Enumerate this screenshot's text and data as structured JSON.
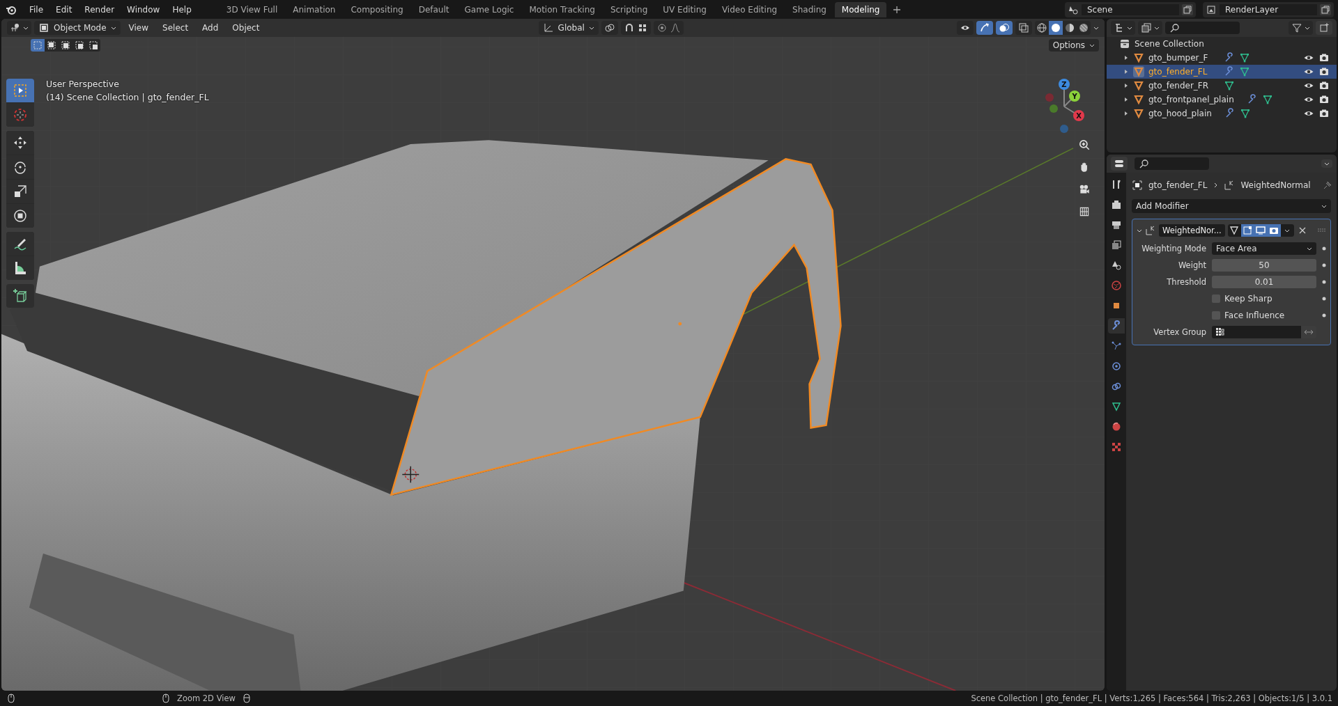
{
  "menu": [
    "File",
    "Edit",
    "Render",
    "Window",
    "Help"
  ],
  "workspaces": [
    {
      "label": "3D View Full",
      "selected": false
    },
    {
      "label": "Animation",
      "selected": false
    },
    {
      "label": "Compositing",
      "selected": false
    },
    {
      "label": "Default",
      "selected": false
    },
    {
      "label": "Game Logic",
      "selected": false
    },
    {
      "label": "Motion Tracking",
      "selected": false
    },
    {
      "label": "Scripting",
      "selected": false
    },
    {
      "label": "UV Editing",
      "selected": false
    },
    {
      "label": "Video Editing",
      "selected": false
    },
    {
      "label": "Shading",
      "selected": false
    },
    {
      "label": "Modeling",
      "selected": true
    }
  ],
  "scene": "Scene",
  "view_layer": "RenderLayer",
  "viewport": {
    "mode": "Object Mode",
    "menus": [
      "View",
      "Select",
      "Add",
      "Object"
    ],
    "orientation": "Global",
    "options": "Options",
    "select_modes": [
      {
        "selected": true
      },
      {
        "selected": false
      },
      {
        "selected": false
      },
      {
        "selected": false
      },
      {
        "selected": false
      }
    ],
    "shading": [
      {
        "kind": "wireframe",
        "selected": false
      },
      {
        "kind": "solid",
        "selected": true
      },
      {
        "kind": "material",
        "selected": false
      },
      {
        "kind": "rendered",
        "selected": false
      }
    ],
    "view_name": "User Perspective",
    "info": "(14) Scene Collection | gto_fender_FL",
    "gizmo": {
      "x": "X",
      "y": "Y",
      "z": "Z"
    },
    "tool_groups": [
      {
        "tools": [
          {
            "kind": "select",
            "selected": true
          },
          {
            "kind": "cursor",
            "selected": false
          }
        ]
      },
      {
        "tools": [
          {
            "kind": "move",
            "selected": false
          },
          {
            "kind": "rotate",
            "selected": false
          },
          {
            "kind": "scale",
            "selected": false
          },
          {
            "kind": "transform",
            "selected": false
          }
        ]
      },
      {
        "tools": [
          {
            "kind": "annotate",
            "selected": false
          },
          {
            "kind": "measure",
            "selected": false
          }
        ]
      },
      {
        "tools": [
          {
            "kind": "add-cube",
            "selected": false
          }
        ]
      }
    ]
  },
  "outliner": {
    "root": {
      "label": "Scene Collection",
      "children": [
        {
          "name": "gto_bumper_F",
          "selected": false,
          "has_modifier": true,
          "expanded": false
        },
        {
          "name": "gto_fender_FL",
          "selected": true,
          "has_modifier": true,
          "expanded": false
        },
        {
          "name": "gto_fender_FR",
          "selected": false,
          "has_modifier": false,
          "expanded": false
        },
        {
          "name": "gto_frontpanel_plain",
          "selected": false,
          "has_modifier": true,
          "expanded": false
        },
        {
          "name": "gto_hood_plain",
          "selected": false,
          "has_modifier": true,
          "expanded": false
        }
      ]
    }
  },
  "properties": {
    "tabs": [
      {
        "kind": "tool",
        "selected": false
      },
      {
        "kind": "render",
        "selected": false
      },
      {
        "kind": "output",
        "selected": false
      },
      {
        "kind": "view-layer",
        "selected": false
      },
      {
        "kind": "scene",
        "selected": false
      },
      {
        "kind": "world",
        "selected": false
      },
      {
        "kind": "object",
        "selected": false
      },
      {
        "kind": "modifier",
        "selected": true
      },
      {
        "kind": "particles",
        "selected": false
      },
      {
        "kind": "physics",
        "selected": false
      },
      {
        "kind": "constraints",
        "selected": false
      },
      {
        "kind": "data",
        "selected": false
      },
      {
        "kind": "material",
        "selected": false
      },
      {
        "kind": "texture",
        "selected": false
      }
    ],
    "object": "gto_fender_FL",
    "modifier": "WeightedNormal",
    "add_modifier": "Add Modifier",
    "panel": {
      "name": "WeightedNor...",
      "expanded": true,
      "toggles": [
        {
          "kind": "cage",
          "on": false
        },
        {
          "kind": "edit",
          "on": true
        },
        {
          "kind": "viewport",
          "on": true
        },
        {
          "kind": "render",
          "on": true
        }
      ],
      "fields": [
        {
          "kind": "dropdown",
          "label": "Weighting Mode",
          "value": "Face Area"
        },
        {
          "kind": "number",
          "label": "Weight",
          "value": "50"
        },
        {
          "kind": "number",
          "label": "Threshold",
          "value": "0.01"
        },
        {
          "kind": "checkbox",
          "label": "Keep Sharp",
          "checked": false
        },
        {
          "kind": "checkbox",
          "label": "Face Influence",
          "checked": false
        },
        {
          "kind": "group",
          "label": "Vertex Group"
        }
      ]
    }
  },
  "status_bar": {
    "hint": "Zoom 2D View",
    "stats": "Scene Collection | gto_fender_FL | Verts:1,265 | Faces:564 | Tris:2,263 | Objects:1/5 | 3.0.1"
  }
}
